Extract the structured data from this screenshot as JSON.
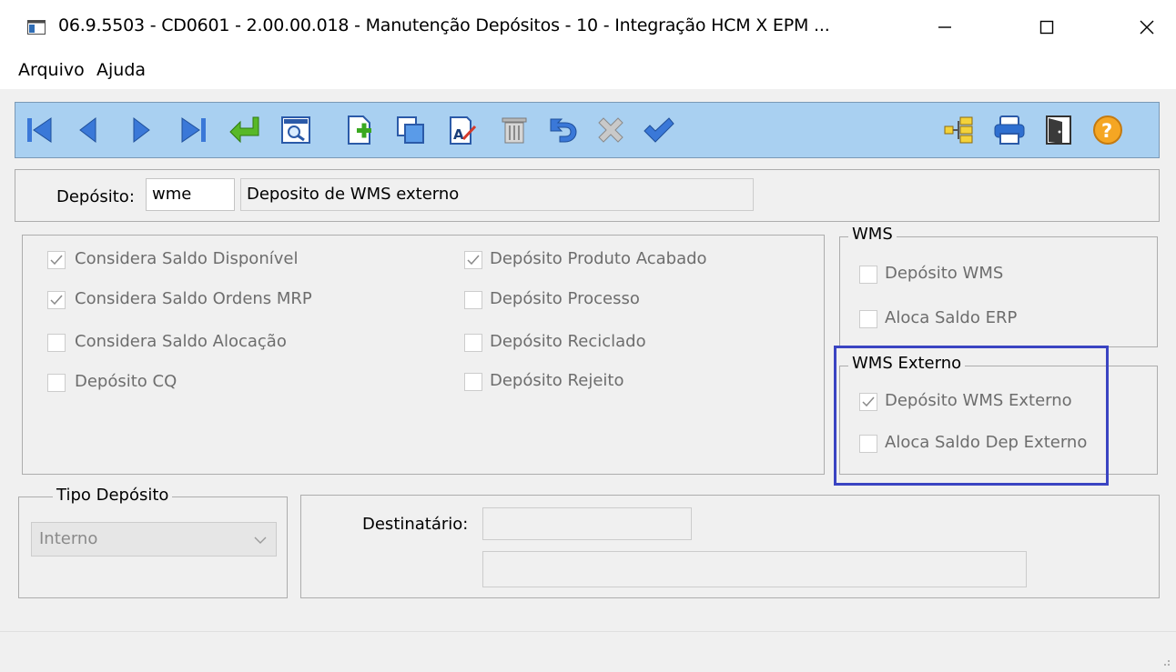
{
  "window": {
    "title": "06.9.5503 - CD0601 - 2.00.00.018 - Manutenção Depósitos - 10 - Integração HCM X EPM ...",
    "icon": "app-window-icon",
    "minimize_icon": "minimize-icon",
    "maximize_icon": "maximize-icon",
    "close_icon": "close-icon"
  },
  "menu": [
    "Arquivo",
    "Ajuda"
  ],
  "toolbar": {
    "left": [
      "first-record-icon",
      "previous-record-icon",
      "next-record-icon",
      "last-record-icon",
      "go-to-icon",
      "search-icon",
      "new-record-icon",
      "copy-record-icon",
      "edit-record-icon",
      "delete-record-icon",
      "undo-icon",
      "cancel-icon",
      "save-icon"
    ],
    "right": [
      "tree-icon",
      "print-icon",
      "exit-icon",
      "help-icon"
    ]
  },
  "deposit": {
    "label": "Depósito:",
    "code": "wme",
    "description": "Deposito de WMS externo"
  },
  "options": {
    "col1": [
      {
        "label": "Considera Saldo Disponível",
        "checked": true
      },
      {
        "label": "Considera Saldo Ordens MRP",
        "checked": true
      },
      {
        "label": "Considera Saldo Alocação",
        "checked": false
      },
      {
        "label": "Depósito CQ",
        "checked": false
      }
    ],
    "col2": [
      {
        "label": "Depósito Produto Acabado",
        "checked": true
      },
      {
        "label": "Depósito Processo",
        "checked": false
      },
      {
        "label": "Depósito Reciclado",
        "checked": false
      },
      {
        "label": "Depósito Rejeito",
        "checked": false
      }
    ]
  },
  "wms": {
    "title": "WMS",
    "items": [
      {
        "label": "Depósito WMS",
        "checked": false
      },
      {
        "label": "Aloca Saldo ERP",
        "checked": false
      }
    ]
  },
  "wms_externo": {
    "title": "WMS Externo",
    "items": [
      {
        "label": "Depósito WMS Externo",
        "checked": true
      },
      {
        "label": "Aloca Saldo Dep Externo",
        "checked": false
      }
    ]
  },
  "tipo_deposito": {
    "title": "Tipo Depósito",
    "value": "Interno"
  },
  "destinatario": {
    "label": "Destinatário:",
    "code": "",
    "name": ""
  },
  "colors": {
    "toolbar": "#a9d0f1",
    "highlight": "#3a44c2",
    "window": "#f0f0f0"
  }
}
